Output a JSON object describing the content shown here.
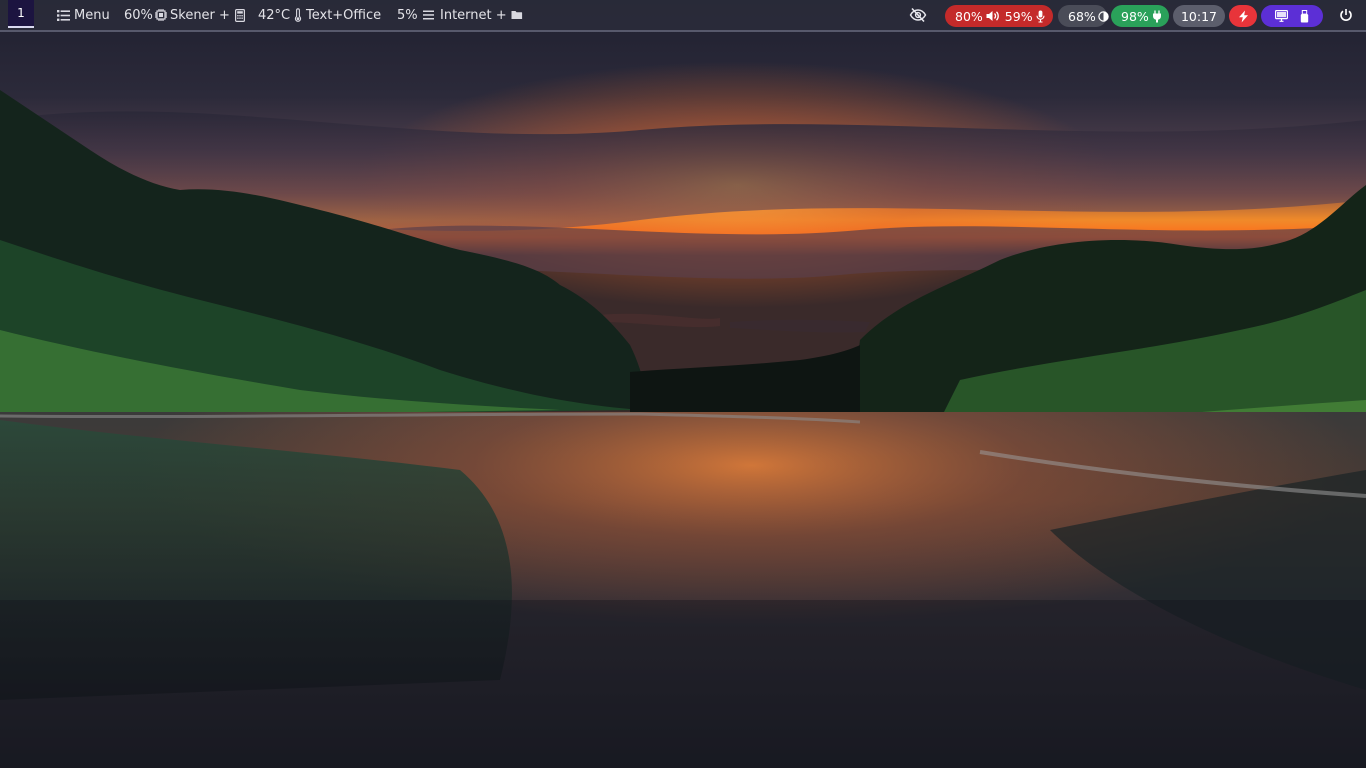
{
  "colors": {
    "bar_bg": "#2c2e3c",
    "audio_pill": "#c42a2a",
    "brightness_pill": "#4a4c58",
    "battery_pill": "#2aa15a",
    "clock_pill": "#5c5e6c",
    "power_pill": "#e8343a",
    "devices_pill": "#5c2fd6",
    "workspace_bg": "#1c1440"
  },
  "workspace": {
    "number": "1"
  },
  "menu": {
    "icon": "list-icon",
    "label": "Menu"
  },
  "cpu": {
    "value": "60%",
    "icon": "cpu-chip-icon"
  },
  "scanner": {
    "label": "Skener +",
    "icon": "calculator-icon"
  },
  "temperature": {
    "value": "42°C",
    "icon": "thermometer-icon"
  },
  "office": {
    "label": "Text+Office"
  },
  "memory": {
    "value": "5%",
    "icon": "lines-icon"
  },
  "internet": {
    "label": "Internet +",
    "icon": "folder-icon"
  },
  "tray": {
    "hide_icon": "eye-slash-icon",
    "volume": {
      "value": "80%",
      "icon": "speaker-icon"
    },
    "mic": {
      "value": "59%",
      "icon": "microphone-icon"
    },
    "brightness": {
      "value": "68%",
      "icon": "contrast-icon"
    },
    "battery": {
      "value": "98%",
      "icon": "plug-icon"
    },
    "clock": {
      "time": "10:17"
    },
    "power_profile": {
      "icon": "lightning-icon"
    },
    "devices": {
      "icons": [
        "monitor-icon",
        "usb-drive-icon"
      ]
    },
    "shutdown": {
      "icon": "power-icon"
    }
  },
  "wallpaper": {
    "subject": "river at sunset wallpaper"
  }
}
